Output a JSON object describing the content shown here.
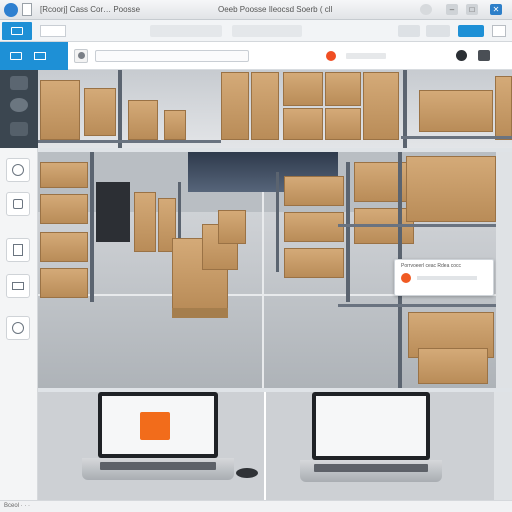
{
  "window": {
    "app_title": "[Rcoorj] Cass Cor…  Poosse",
    "window_title": "Oeeb Poosse   Ileocsd Soerb (  cll"
  },
  "toolbar": {
    "home_label": "",
    "tab_label": "",
    "right_label": ""
  },
  "header": {
    "search_placeholder": "",
    "notification_label": "",
    "accent": "#f04e23"
  },
  "popup": {
    "text": "Porrvoeerl  ceac  Rdea  cocc"
  },
  "statusbar": {
    "text": "Bceol  ·  ·  ·"
  },
  "colors": {
    "accent_blue": "#1e90d6",
    "accent_orange": "#f26c1b",
    "sidebar_dark": "#3b4650"
  },
  "icons": [
    "browser-icon",
    "window-icon",
    "tab-icon",
    "avatar-icon",
    "search-icon",
    "bell-icon",
    "settings-icon",
    "cart-icon"
  ]
}
